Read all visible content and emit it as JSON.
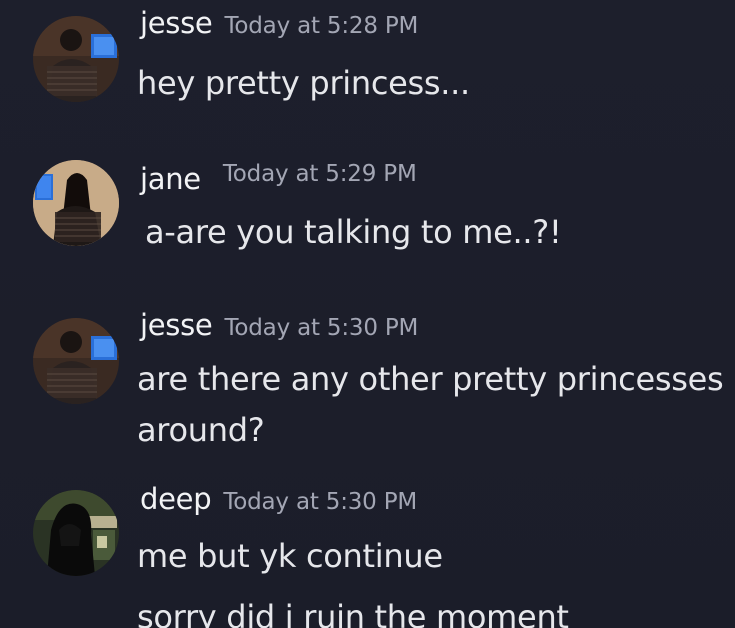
{
  "messages": [
    {
      "username": "jesse",
      "timestamp": "Today at 5:28 PM",
      "avatar_icon": "user-avatar-person-at-computer",
      "lines": [
        "hey pretty princess..."
      ]
    },
    {
      "username": "jane",
      "timestamp": "Today at 5:29 PM",
      "avatar_icon": "user-avatar-girl-at-computer",
      "lines": [
        "a-are you talking to me..?!"
      ]
    },
    {
      "username": "jesse",
      "timestamp": "Today at 5:30 PM",
      "avatar_icon": "user-avatar-person-at-computer",
      "lines": [
        "are there any other pretty princesses",
        "around?"
      ]
    },
    {
      "username": "deep",
      "timestamp": "Today at 5:30 PM",
      "avatar_icon": "user-avatar-hooded-figure",
      "lines": [
        "me but yk continue",
        "sorry did i ruin the moment"
      ]
    }
  ]
}
